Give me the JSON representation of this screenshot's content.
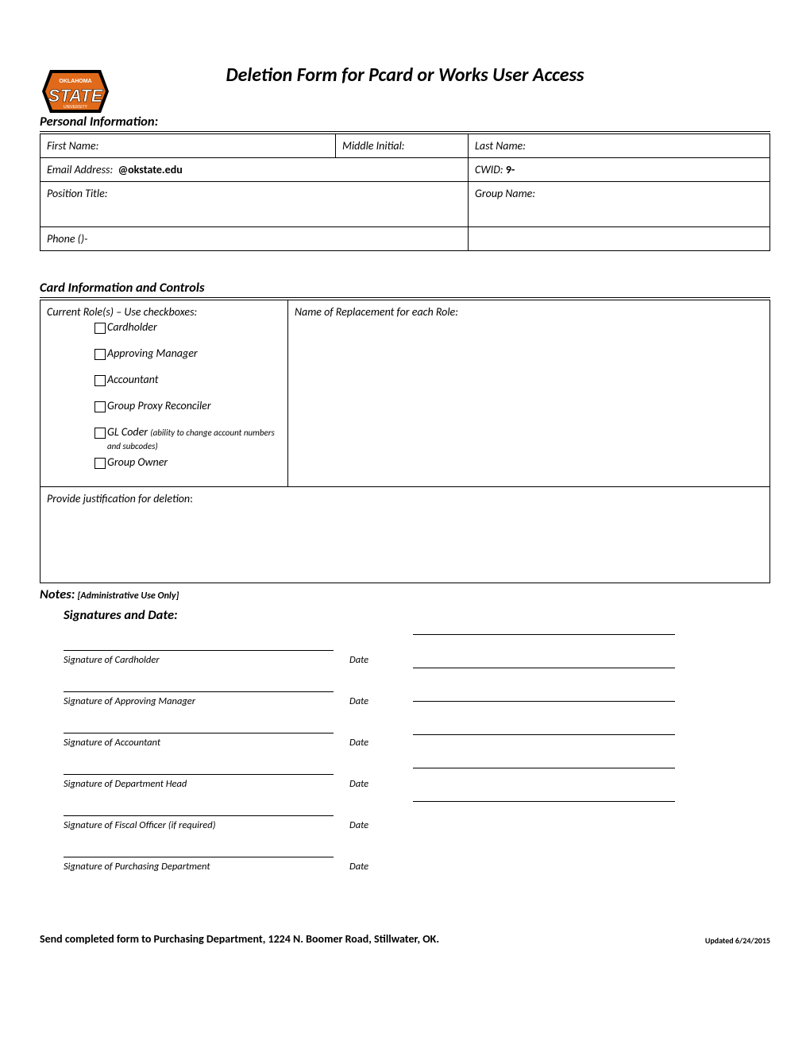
{
  "title": "Deletion Form for Pcard or Works User Access",
  "sections": {
    "personal": "Personal Information:",
    "card": "Card Information and Controls",
    "notes_label": "Notes:",
    "notes_sub": "[Administrative Use Only]",
    "sig": "Signatures and Date:"
  },
  "fields": {
    "first_name": "First Name:",
    "middle_initial": "Middle Initial:",
    "last_name": "Last Name:",
    "email": "Email Address:",
    "email_domain": "@okstate.edu",
    "cwid": "CWID:",
    "cwid_prefix": "9-",
    "position_title": "Position Title:",
    "group_name": "Group Name:",
    "phone": "Phone ()-"
  },
  "roles": {
    "heading": "Current Role(s) – Use checkboxes:",
    "replacement": "Name of Replacement for each Role:",
    "items": {
      "cardholder": "Cardholder",
      "approving_manager": "Approving Manager",
      "accountant": "Accountant",
      "group_proxy": "Group Proxy Reconciler",
      "gl_coder": "GL Coder",
      "gl_coder_sub": "(ability to change account numbers and subcodes)",
      "group_owner": "Group Owner"
    }
  },
  "justification": "Provide justification for deletion",
  "signatures": {
    "cardholder": "Signature of Cardholder",
    "app_manager": "Signature of Approving Manager",
    "accountant": "Signature of Accountant",
    "dept_head": "Signature of Department Head",
    "fiscal": "Signature of Fiscal Officer (if required)",
    "purchasing": "Signature of Purchasing Department",
    "date": "Date"
  },
  "footer": {
    "send": "Send completed form to Purchasing Department, 1224 N. Boomer Road, Stillwater, OK.",
    "updated": "Updated 6/24/2015"
  }
}
